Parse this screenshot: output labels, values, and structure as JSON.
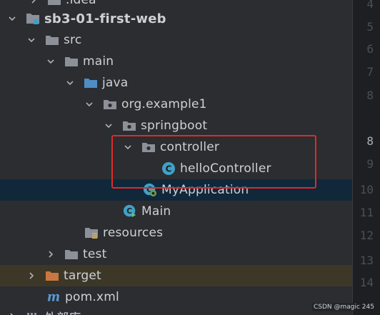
{
  "tree": {
    "rows": [
      {
        "label": ".idea",
        "icon": "folder-icon",
        "expanded": false
      },
      {
        "label": "sb3-01-first-web",
        "icon": "module-folder-icon",
        "expanded": true
      },
      {
        "label": "src",
        "icon": "folder-icon",
        "expanded": true
      },
      {
        "label": "main",
        "icon": "folder-icon",
        "expanded": true
      },
      {
        "label": "java",
        "icon": "source-folder-icon",
        "expanded": true
      },
      {
        "label": "org.example1",
        "icon": "package-icon",
        "expanded": true
      },
      {
        "label": "springboot",
        "icon": "package-icon",
        "expanded": true
      },
      {
        "label": "controller",
        "icon": "package-icon",
        "expanded": true
      },
      {
        "label": "helloController",
        "icon": "java-class-icon"
      },
      {
        "label": "MyApplication",
        "icon": "spring-boot-class-icon",
        "selected": true
      },
      {
        "label": "Main",
        "icon": "java-main-class-icon"
      },
      {
        "label": "resources",
        "icon": "resources-folder-icon"
      },
      {
        "label": "test",
        "icon": "folder-icon",
        "expanded": false
      },
      {
        "label": "target",
        "icon": "excluded-folder-icon",
        "expanded": false
      },
      {
        "label": "pom.xml",
        "icon": "maven-icon"
      },
      {
        "label": "外部库",
        "icon": "libraries-icon"
      }
    ]
  },
  "gutter": {
    "line_numbers": [
      "4",
      "5",
      "6",
      "7",
      "8",
      "9",
      "10",
      "11",
      "12",
      "13",
      "14"
    ],
    "current_line": "8"
  },
  "watermark": "CSDN @magic 245",
  "colors": {
    "background": "#2b2d30",
    "selection": "#11273a",
    "excluded_row": "#3d3728",
    "highlight_box": "#e02a2a",
    "class_icon": "#3fa1c9",
    "folder_icon": "#8c9199",
    "source_folder": "#4d8ec4",
    "excluded_folder": "#c87740",
    "maven_icon": "#5b9bd5"
  }
}
